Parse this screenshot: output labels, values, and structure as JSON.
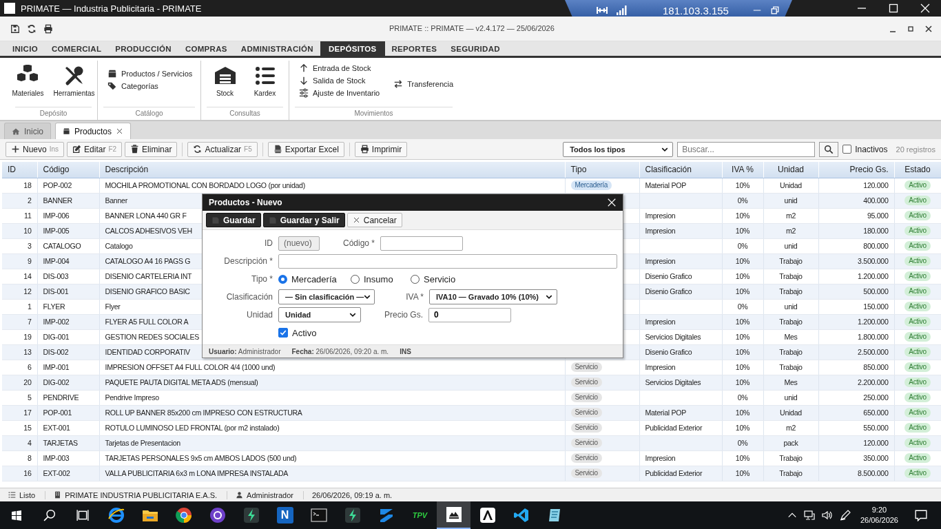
{
  "os_titlebar": {
    "title": "PRIMATE — Industria Publicitaria - PRIMATE"
  },
  "remote_bar": {
    "address": "181.103.3.155"
  },
  "app_header": {
    "title": "PRIMATE :: PRIMATE — v2.4.172 — 25/06/2026"
  },
  "menu_tabs": [
    {
      "label": "INICIO",
      "selected": false
    },
    {
      "label": "COMERCIAL",
      "selected": false
    },
    {
      "label": "PRODUCCIÓN",
      "selected": false
    },
    {
      "label": "COMPRAS",
      "selected": false
    },
    {
      "label": "ADMINISTRACIÓN",
      "selected": false
    },
    {
      "label": "DEPÓSITOS",
      "selected": true
    },
    {
      "label": "REPORTES",
      "selected": false
    },
    {
      "label": "SEGURIDAD",
      "selected": false
    }
  ],
  "ribbon": [
    {
      "name": "Depósito",
      "kind": "large",
      "items": [
        {
          "label": "Materiales"
        },
        {
          "label": "Herramientas"
        }
      ]
    },
    {
      "name": "Catálogo",
      "kind": "small",
      "columns": [
        [
          {
            "label": "Productos / Servicios"
          },
          {
            "label": "Categorías"
          }
        ]
      ]
    },
    {
      "name": "Consultas",
      "kind": "large",
      "items": [
        {
          "label": "Stock"
        },
        {
          "label": "Kardex"
        }
      ]
    },
    {
      "name": "Movimientos",
      "kind": "small",
      "columns": [
        [
          {
            "label": "Entrada de Stock"
          },
          {
            "label": "Salida de Stock"
          },
          {
            "label": "Ajuste de Inventario"
          }
        ],
        [
          {
            "label": "Transferencia"
          }
        ]
      ]
    }
  ],
  "doc_tabs": [
    {
      "label": "Inicio",
      "selected": false,
      "closable": false
    },
    {
      "label": "Productos",
      "selected": true,
      "closable": true
    }
  ],
  "toolbar": {
    "buttons": [
      {
        "label": "Nuevo",
        "shortcut": "Ins",
        "separator_before": false
      },
      {
        "label": "Editar",
        "shortcut": "F2",
        "separator_before": false
      },
      {
        "label": "Eliminar",
        "separator_before": false
      },
      {
        "label": "Actualizar",
        "shortcut": "F5",
        "separator_before": true
      },
      {
        "label": "Exportar Excel",
        "separator_before": true
      },
      {
        "label": "Imprimir",
        "separator_before": true
      }
    ],
    "type_filter": "Todos los tipos",
    "search": {
      "placeholder": "Buscar..."
    },
    "inactive_filter": {
      "label": "Inactivos",
      "checked": false
    },
    "count": "20 registros"
  },
  "table": {
    "columns": [
      "ID",
      "Código",
      "Descripción",
      "Tipo",
      "Clasificación",
      "IVA %",
      "Unidad",
      "Precio Gs.",
      "Estado"
    ],
    "rows": [
      {
        "id": "18",
        "code": "POP-002",
        "description": "MOCHILA PROMOTIONAL CON BORDADO LOGO (por unidad)",
        "type": {
          "label": "Mercadería",
          "kind": "goods"
        },
        "classification": "Material POP",
        "vat": "10%",
        "unit": "Unidad",
        "price": "120.000",
        "status": "Activo"
      },
      {
        "id": "2",
        "code": "BANNER",
        "description": "Banner",
        "vat": "0%",
        "unit": "unid",
        "price": "400.000",
        "status": "Activo"
      },
      {
        "id": "11",
        "code": "IMP-006",
        "description": "BANNER LONA 440 GR F",
        "classification": "Impresion",
        "vat": "10%",
        "unit": "m2",
        "price": "95.000",
        "status": "Activo"
      },
      {
        "id": "10",
        "code": "IMP-005",
        "description": "CALCOS ADHESIVOS VEH",
        "classification": "Impresion",
        "vat": "10%",
        "unit": "m2",
        "price": "180.000",
        "status": "Activo"
      },
      {
        "id": "3",
        "code": "CATALOGO",
        "description": "Catalogo",
        "vat": "0%",
        "unit": "unid",
        "price": "800.000",
        "status": "Activo"
      },
      {
        "id": "9",
        "code": "IMP-004",
        "description": "CATALOGO A4 16 PAGS G",
        "classification": "Impresion",
        "vat": "10%",
        "unit": "Trabajo",
        "price": "3.500.000",
        "status": "Activo"
      },
      {
        "id": "14",
        "code": "DIS-003",
        "description": "DISENIO CARTELERIA INT",
        "classification": "Disenio Grafico",
        "vat": "10%",
        "unit": "Trabajo",
        "price": "1.200.000",
        "status": "Activo"
      },
      {
        "id": "12",
        "code": "DIS-001",
        "description": "DISENIO GRAFICO BASIC",
        "classification": "Disenio Grafico",
        "vat": "10%",
        "unit": "Trabajo",
        "price": "500.000",
        "status": "Activo"
      },
      {
        "id": "1",
        "code": "FLYER",
        "description": "Flyer",
        "vat": "0%",
        "unit": "unid",
        "price": "150.000",
        "status": "Activo"
      },
      {
        "id": "7",
        "code": "IMP-002",
        "description": "FLYER A5 FULL COLOR A",
        "classification": "Impresion",
        "vat": "10%",
        "unit": "Trabajo",
        "price": "1.200.000",
        "status": "Activo"
      },
      {
        "id": "19",
        "code": "DIG-001",
        "description": "GESTION REDES SOCIALES",
        "classification": "Servicios Digitales",
        "vat": "10%",
        "unit": "Mes",
        "price": "1.800.000",
        "status": "Activo"
      },
      {
        "id": "13",
        "code": "DIS-002",
        "description": "IDENTIDAD CORPORATIV",
        "classification": "Disenio Grafico",
        "vat": "10%",
        "unit": "Trabajo",
        "price": "2.500.000",
        "status": "Activo"
      },
      {
        "id": "6",
        "code": "IMP-001",
        "description": "IMPRESION OFFSET A4 FULL COLOR 4/4 (1000 und)",
        "type": {
          "label": "Servicio",
          "kind": "service"
        },
        "classification": "Impresion",
        "vat": "10%",
        "unit": "Trabajo",
        "price": "850.000",
        "status": "Activo"
      },
      {
        "id": "20",
        "code": "DIG-002",
        "description": "PAQUETE PAUTA DIGITAL META ADS (mensual)",
        "type": {
          "label": "Servicio",
          "kind": "service"
        },
        "classification": "Servicios Digitales",
        "vat": "10%",
        "unit": "Mes",
        "price": "2.200.000",
        "status": "Activo"
      },
      {
        "id": "5",
        "code": "PENDRIVE",
        "description": "Pendrive Impreso",
        "type": {
          "label": "Servicio",
          "kind": "service"
        },
        "vat": "0%",
        "unit": "unid",
        "price": "250.000",
        "status": "Activo"
      },
      {
        "id": "17",
        "code": "POP-001",
        "description": "ROLL UP BANNER 85x200 cm IMPRESO CON ESTRUCTURA",
        "type": {
          "label": "Servicio",
          "kind": "service"
        },
        "classification": "Material POP",
        "vat": "10%",
        "unit": "Unidad",
        "price": "650.000",
        "status": "Activo"
      },
      {
        "id": "15",
        "code": "EXT-001",
        "description": "ROTULO LUMINOSO LED FRONTAL (por m2 instalado)",
        "type": {
          "label": "Servicio",
          "kind": "service"
        },
        "classification": "Publicidad Exterior",
        "vat": "10%",
        "unit": "m2",
        "price": "550.000",
        "status": "Activo"
      },
      {
        "id": "4",
        "code": "TARJETAS",
        "description": "Tarjetas de Presentacion",
        "type": {
          "label": "Servicio",
          "kind": "service"
        },
        "vat": "0%",
        "unit": "pack",
        "price": "120.000",
        "status": "Activo"
      },
      {
        "id": "8",
        "code": "IMP-003",
        "description": "TARJETAS PERSONALES 9x5 cm AMBOS LADOS (500 und)",
        "type": {
          "label": "Servicio",
          "kind": "service"
        },
        "classification": "Impresion",
        "vat": "10%",
        "unit": "Trabajo",
        "price": "350.000",
        "status": "Activo"
      },
      {
        "id": "16",
        "code": "EXT-002",
        "description": "VALLA PUBLICITARIA 6x3 m LONA IMPRESA INSTALADA",
        "type": {
          "label": "Servicio",
          "kind": "service"
        },
        "classification": "Publicidad Exterior",
        "vat": "10%",
        "unit": "Trabajo",
        "price": "8.500.000",
        "status": "Activo"
      }
    ]
  },
  "dialog": {
    "title": "Productos - Nuevo",
    "buttons": [
      {
        "label": "Guardar",
        "kind": "primary"
      },
      {
        "label": "Guardar y Salir",
        "kind": "primary"
      },
      {
        "label": "Cancelar",
        "kind": "cancel"
      }
    ],
    "id": {
      "label": "ID",
      "value": "(nuevo)"
    },
    "code": {
      "label": "Código *"
    },
    "description": {
      "label": "Descripción *"
    },
    "type": {
      "label": "Tipo *",
      "options": [
        {
          "label": "Mercadería",
          "selected": true
        },
        {
          "label": "Insumo",
          "selected": false
        },
        {
          "label": "Servicio",
          "selected": false
        }
      ]
    },
    "classification": {
      "label": "Clasificación",
      "value": "— Sin clasificación —"
    },
    "vat": {
      "label": "IVA *",
      "value": "IVA10 — Gravado 10% (10%)"
    },
    "unit": {
      "label": "Unidad",
      "value": "Unidad"
    },
    "price": {
      "label": "Precio Gs.",
      "value": "0"
    },
    "active": {
      "label": "Activo",
      "checked": true
    },
    "footer": [
      "**Usuario:** Administrador",
      "**Fecha:** 26/06/2026, 09:20 a. m.",
      "**INS**"
    ]
  },
  "status_bar": [
    "Listo",
    "PRIMATE INDUSTRIA PUBLICITARIA E.A.S.",
    "Administrador",
    "26/06/2026, 09:19 a. m."
  ],
  "taskbar": {
    "apps": [
      {
        "kind": "browser",
        "selected": false
      },
      {
        "kind": "folder",
        "selected": false
      },
      {
        "kind": "chrome",
        "selected": false
      },
      {
        "kind": "octocat",
        "selected": false
      },
      {
        "kind": "bolt",
        "selected": false
      },
      {
        "kind": "letter",
        "label": "N",
        "selected": false
      },
      {
        "kind": "terminal",
        "selected": false
      },
      {
        "kind": "bolt",
        "selected": false
      },
      {
        "kind": "stack",
        "selected": false
      },
      {
        "kind": "text",
        "label": "TPV",
        "selected": false
      },
      {
        "kind": "logo",
        "selected": true
      },
      {
        "kind": "peak",
        "selected": false
      },
      {
        "kind": "code",
        "selected": false
      },
      {
        "kind": "notepad",
        "selected": false
      }
    ],
    "time": "9:20",
    "date": "26/06/2026"
  }
}
